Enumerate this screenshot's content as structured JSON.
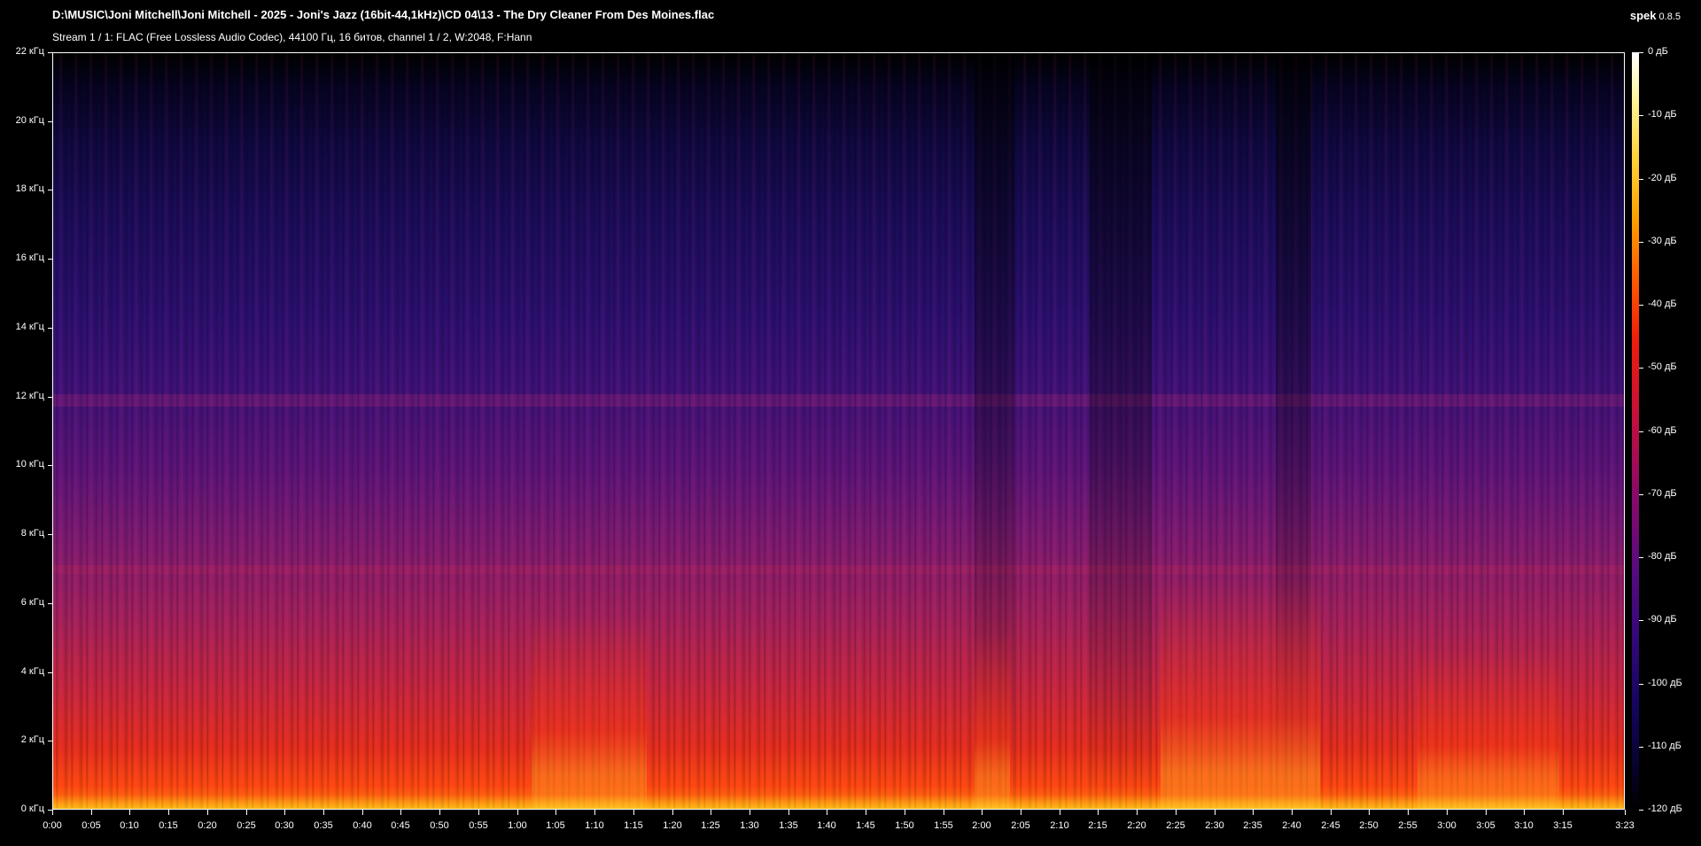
{
  "header": {
    "file_path": "D:\\MUSIC\\Joni Mitchell\\Joni Mitchell - 2025 - Joni's Jazz (16bit-44,1kHz)\\CD 04\\13 - The Dry Cleaner From Des Moines.flac",
    "stream_info": "Stream 1 / 1: FLAC (Free Lossless Audio Codec), 44100 Гц, 16 битов, channel 1 / 2, W:2048, F:Hann",
    "app_name": "spek",
    "app_version": "0.8.5"
  },
  "frequency_axis": {
    "labels": [
      "22 кГц",
      "20 кГц",
      "18 кГц",
      "16 кГц",
      "14 кГц",
      "12 кГц",
      "10 кГц",
      "8 кГц",
      "6 кГц",
      "4 кГц",
      "2 кГц",
      "0 кГц"
    ],
    "values_khz": [
      22,
      20,
      18,
      16,
      14,
      12,
      10,
      8,
      6,
      4,
      2,
      0
    ],
    "max_khz": 22
  },
  "time_axis": {
    "labels": [
      "0:00",
      "0:05",
      "0:10",
      "0:15",
      "0:20",
      "0:25",
      "0:30",
      "0:35",
      "0:40",
      "0:45",
      "0:50",
      "0:55",
      "1:00",
      "1:05",
      "1:10",
      "1:15",
      "1:20",
      "1:25",
      "1:30",
      "1:35",
      "1:40",
      "1:45",
      "1:50",
      "1:55",
      "2:00",
      "2:05",
      "2:10",
      "2:15",
      "2:20",
      "2:25",
      "2:30",
      "2:35",
      "2:40",
      "2:45",
      "2:50",
      "2:55",
      "3:00",
      "3:05",
      "3:10",
      "3:15",
      "3:23"
    ],
    "values_sec": [
      0,
      5,
      10,
      15,
      20,
      25,
      30,
      35,
      40,
      45,
      50,
      55,
      60,
      65,
      70,
      75,
      80,
      85,
      90,
      95,
      100,
      105,
      110,
      115,
      120,
      125,
      130,
      135,
      140,
      145,
      150,
      155,
      160,
      165,
      170,
      175,
      180,
      185,
      190,
      195,
      203
    ],
    "duration_sec": 203
  },
  "color_scale": {
    "labels": [
      "0 дБ",
      "-10 дБ",
      "-20 дБ",
      "-30 дБ",
      "-40 дБ",
      "-50 дБ",
      "-60 дБ",
      "-70 дБ",
      "-80 дБ",
      "-90 дБ",
      "-100 дБ",
      "-110 дБ",
      "-120 дБ"
    ],
    "values_db": [
      0,
      -10,
      -20,
      -30,
      -40,
      -50,
      -60,
      -70,
      -80,
      -90,
      -100,
      -110,
      -120
    ],
    "min_db": -120,
    "max_db": 0
  },
  "colors": {
    "background": "#000000",
    "text": "#ffffff"
  }
}
